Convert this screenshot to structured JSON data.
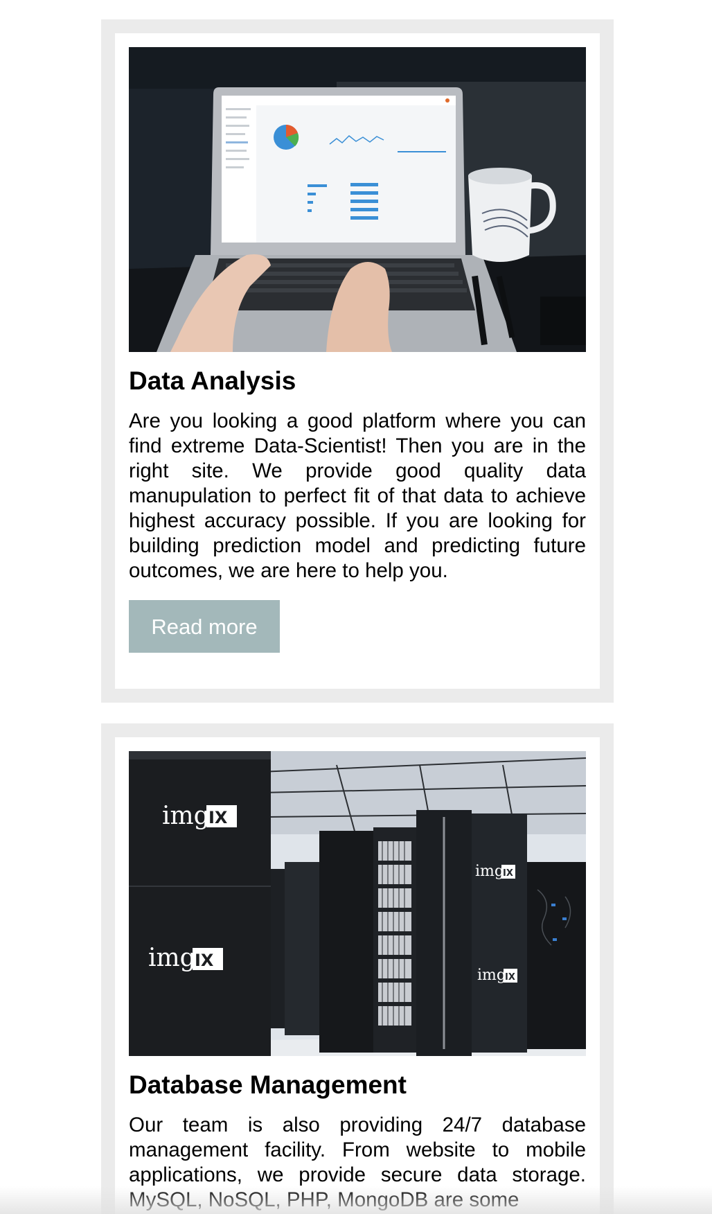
{
  "cards": [
    {
      "image_alt": "Laptop showing an analytics dashboard with a coffee mug and pens",
      "title": "Data Analysis",
      "text": "Are you looking a good platform where you can find extreme Data-Scientist! Then you are in the right site. We provide good quality data manupulation to perfect fit of that data to achieve highest accuracy possible. If you are looking for building prediction model and predicting future outcomes, we are here to help you.",
      "button_label": "Read more"
    },
    {
      "image_alt": "Server racks in a data center branded imgIX",
      "title": "Database Management",
      "text": "Our team is also providing 24/7 database management facility. From website to mobile applications, we provide secure data storage. MySQL, NoSQL, PHP, MongoDB are some",
      "image_brand": "img",
      "image_brand_box": "IX"
    }
  ],
  "colors": {
    "card_border": "#ebebeb",
    "button_bg": "#a3b8ba",
    "button_text": "#ffffff"
  }
}
